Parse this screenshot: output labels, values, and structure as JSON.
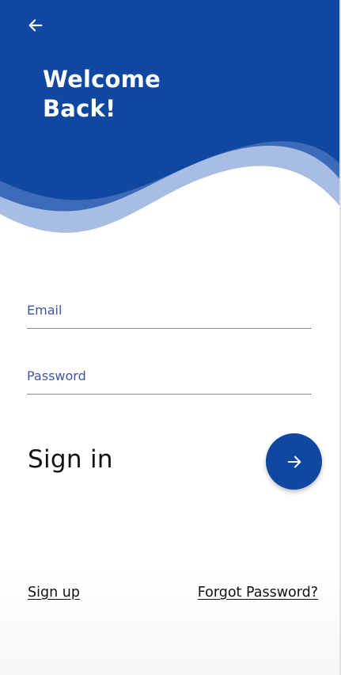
{
  "header": {
    "back_icon": "arrow-left-icon",
    "title_line1": "Welcome",
    "title_line2": "Back!"
  },
  "form": {
    "email": {
      "placeholder": "Email",
      "value": ""
    },
    "password": {
      "placeholder": "Password",
      "value": ""
    }
  },
  "actions": {
    "sign_in_label": "Sign in",
    "sign_in_icon": "arrow-right-icon",
    "sign_up_label": "Sign up",
    "forgot_password_label": "Forgot Password?"
  },
  "colors": {
    "primary": "#0f47a1",
    "wave_mid": "#3d6ab8",
    "wave_light": "#a7bde2",
    "label_blue": "#3d57a6"
  }
}
